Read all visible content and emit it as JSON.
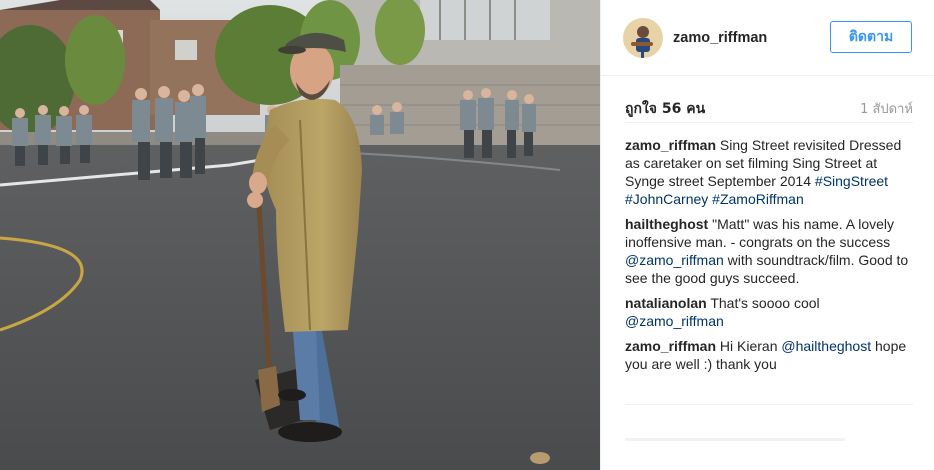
{
  "post": {
    "username": "zamo_riffman",
    "follow_label": "ติดตาม",
    "likes": "ถูกใจ 56 คน",
    "time_ago": "1 สัปดาห์"
  },
  "comments": [
    {
      "user": "zamo_riffman",
      "parts": [
        {
          "t": "text",
          "v": "Sing Street revisited Dressed as caretaker on set filming Sing Street at Synge street September 2014 "
        },
        {
          "t": "link",
          "v": "#SingStreet"
        },
        {
          "t": "text",
          "v": " "
        },
        {
          "t": "link",
          "v": "#JohnCarney"
        },
        {
          "t": "text",
          "v": " "
        },
        {
          "t": "link",
          "v": "#ZamoRiffman"
        }
      ]
    },
    {
      "user": "hailtheghost",
      "parts": [
        {
          "t": "text",
          "v": "\"Matt\" was his name. A lovely inoffensive man. - congrats on the success "
        },
        {
          "t": "link",
          "v": "@zamo_riffman"
        },
        {
          "t": "text",
          "v": " with soundtrack/film. Good to see the good guys succeed."
        }
      ]
    },
    {
      "user": "natalianolan",
      "parts": [
        {
          "t": "text",
          "v": "That's soooo cool "
        },
        {
          "t": "link",
          "v": "@zamo_riffman"
        }
      ]
    },
    {
      "user": "zamo_riffman",
      "parts": [
        {
          "t": "text",
          "v": "Hi Kieran "
        },
        {
          "t": "link",
          "v": "@hailtheghost"
        },
        {
          "t": "text",
          "v": " hope you are well :) thank you"
        }
      ]
    }
  ],
  "colors": {
    "accent": "#3897f0",
    "link": "#003569",
    "muted": "#999999"
  }
}
